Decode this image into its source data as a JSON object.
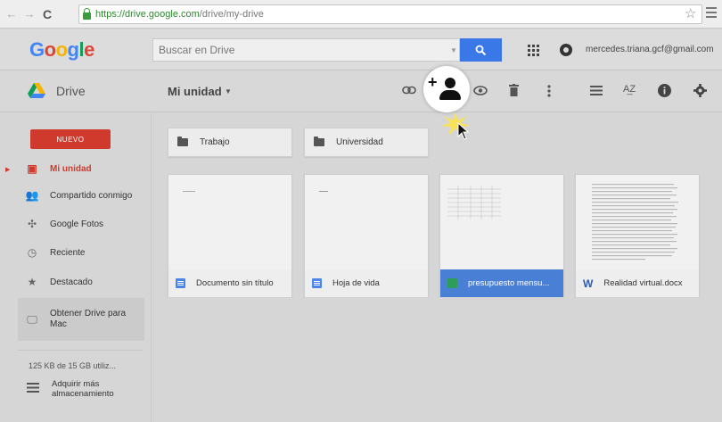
{
  "browser": {
    "url_secure": "https://drive.google.com",
    "url_path": "/drive/my-drive"
  },
  "header": {
    "logo": "Google",
    "search_placeholder": "Buscar en Drive",
    "account_email": "mercedes.triana.gcf@gmail.com"
  },
  "toolbar": {
    "app_label": "Drive",
    "location_label": "Mi unidad"
  },
  "sidebar": {
    "new_button": "NUEVO",
    "items": [
      {
        "label": "Mi unidad",
        "icon": "drive-folder-icon"
      },
      {
        "label": "Compartido conmigo",
        "icon": "shared-people-icon"
      },
      {
        "label": "Google Fotos",
        "icon": "photos-pinwheel-icon"
      },
      {
        "label": "Reciente",
        "icon": "clock-icon"
      },
      {
        "label": "Destacado",
        "icon": "star-icon"
      },
      {
        "label": "Obtener Drive para Mac",
        "icon": "computer-icon"
      }
    ],
    "storage": "125 KB de 15 GB utiliz...",
    "buy_storage": "Adquirir más almacenamiento"
  },
  "folders": [
    {
      "name": "Trabajo"
    },
    {
      "name": "Universidad"
    }
  ],
  "files": [
    {
      "name": "Documento sin título",
      "type": "doc"
    },
    {
      "name": "Hoja de vida",
      "type": "doc"
    },
    {
      "name": "presupuesto mensu...",
      "type": "sheet",
      "selected": true
    },
    {
      "name": "Realidad virtual.docx",
      "type": "word"
    }
  ],
  "colors": {
    "accent_red": "#d03a2d",
    "search_blue": "#3b78e7",
    "selected_blue": "#4a7fd6"
  }
}
